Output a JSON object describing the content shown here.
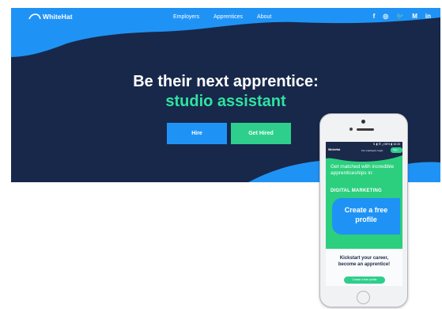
{
  "site": {
    "brand": "WhiteHat",
    "nav": [
      "Employers",
      "Apprentices",
      "About"
    ],
    "social": {
      "facebook": "f",
      "instagram": "◎",
      "twitter": "🐦",
      "medium": "M",
      "linkedin": "in"
    },
    "headline": "Be their next apprentice:",
    "subheadline": "studio assistant",
    "buttons": {
      "hire": "Hire",
      "get_hired": "Get Hired"
    },
    "colors": {
      "navy": "#18284a",
      "blue": "#1f93f5",
      "green": "#2ecf8d",
      "accent_text": "#2ee3a0"
    }
  },
  "mobile": {
    "status": "⇅ ▮ ☰ ◿ 55% ▮ 16:33",
    "brand": "WhiteHat",
    "nav": "For employers  Login",
    "signup": "Sign up",
    "intro": "Get matched with incredible apprenticeships in:",
    "category": "DIGITAL MARKETING",
    "cta_line1": "Create a free",
    "cta_line2": "profile",
    "kickstart_line1": "Kickstart your career,",
    "kickstart_line2": "become an apprentice!",
    "cta_small": "Create a free profile"
  }
}
